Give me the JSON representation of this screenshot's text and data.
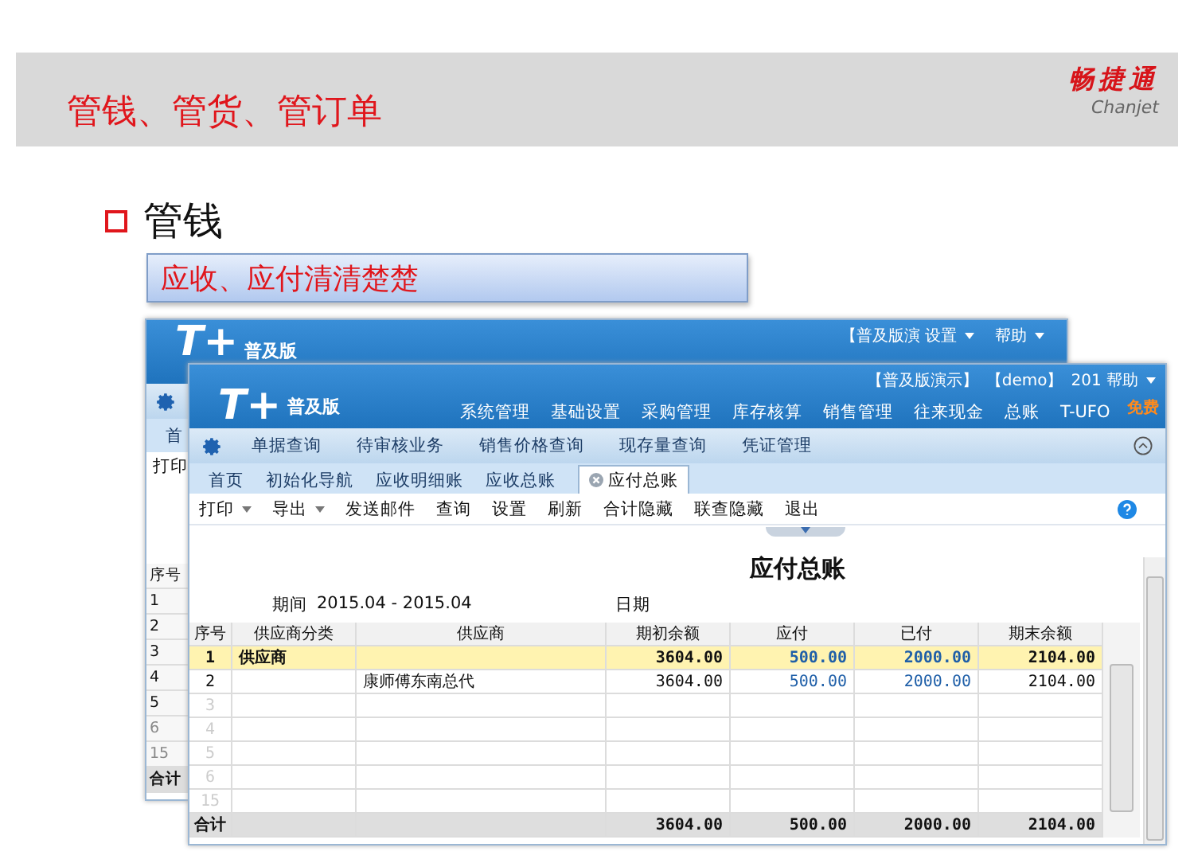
{
  "slide": {
    "title": "管钱、管货、管订单",
    "logo": "畅捷通",
    "logo_subtitle": "Chanjet",
    "bullet": "管钱",
    "callout": "应收、应付清清楚楚"
  },
  "back_window": {
    "logo": "T+",
    "edition": "普及版",
    "top_links": [
      "【普及版演 设置",
      "帮助"
    ],
    "tab": "首",
    "toolbar_item": "打印",
    "row_header": "序号",
    "rows": [
      {
        "label": "1",
        "faded": false
      },
      {
        "label": "2",
        "faded": false
      },
      {
        "label": "3",
        "faded": false
      },
      {
        "label": "4",
        "faded": false
      },
      {
        "label": "5",
        "faded": false
      },
      {
        "label": "6",
        "faded": true
      },
      {
        "label": "15",
        "faded": true
      }
    ],
    "total": "合计"
  },
  "front_window": {
    "logo": "T+",
    "edition": "普及版",
    "top_links": [
      "【普及版演示】",
      "【demo】",
      "201 帮助"
    ],
    "menu": [
      "系统管理",
      "基础设置",
      "采购管理",
      "库存核算",
      "销售管理",
      "往来现金",
      "总账",
      "T-UFO"
    ],
    "menu_badge": "免费",
    "subnav": [
      "单据查询",
      "待审核业务",
      "销售价格查询",
      "现存量查询",
      "凭证管理"
    ],
    "tabs": [
      {
        "label": "首页",
        "selected": false
      },
      {
        "label": "初始化导航",
        "selected": false
      },
      {
        "label": "应收明细账",
        "selected": false
      },
      {
        "label": "应收总账",
        "selected": false
      },
      {
        "label": "应付总账",
        "selected": true
      }
    ],
    "toolbar": [
      {
        "label": "打印",
        "kind": "dropdown"
      },
      {
        "label": "导出",
        "kind": "dropdown"
      },
      {
        "label": "发送邮件",
        "kind": "button"
      },
      {
        "label": "查询",
        "kind": "button"
      },
      {
        "label": "设置",
        "kind": "button"
      },
      {
        "label": "刷新",
        "kind": "button"
      },
      {
        "label": "合计隐藏",
        "kind": "button"
      },
      {
        "label": "联查隐藏",
        "kind": "button"
      },
      {
        "label": "退出",
        "kind": "button"
      }
    ],
    "report": {
      "title": "应付总账",
      "period_label": "期间",
      "period": "2015.04 - 2015.04",
      "date_label": "日期"
    },
    "table": {
      "columns": [
        {
          "label": "序号",
          "kind": "index"
        },
        {
          "label": "供应商分类",
          "kind": "text"
        },
        {
          "label": "供应商",
          "kind": "text"
        },
        {
          "label": "期初余额",
          "kind": "amount"
        },
        {
          "label": "应付",
          "kind": "flow"
        },
        {
          "label": "已付",
          "kind": "flow"
        },
        {
          "label": "期末余额",
          "kind": "amount"
        }
      ],
      "rows": [
        {
          "kind": "group",
          "index": "1",
          "category": "供应商",
          "values": [
            "3604.00",
            "500.00",
            "2000.00",
            "2104.00"
          ]
        },
        {
          "kind": "item",
          "index": "2",
          "supplier": "康师傅东南总代",
          "values": [
            "3604.00",
            "500.00",
            "2000.00",
            "2104.00"
          ]
        },
        {
          "kind": "empty",
          "index": "3"
        },
        {
          "kind": "empty",
          "index": "4"
        },
        {
          "kind": "empty",
          "index": "5"
        },
        {
          "kind": "empty",
          "index": "6"
        },
        {
          "kind": "empty",
          "index": "15"
        }
      ],
      "total": {
        "label": "合计",
        "values": [
          "3604.00",
          "500.00",
          "2000.00",
          "2104.00"
        ]
      }
    }
  }
}
